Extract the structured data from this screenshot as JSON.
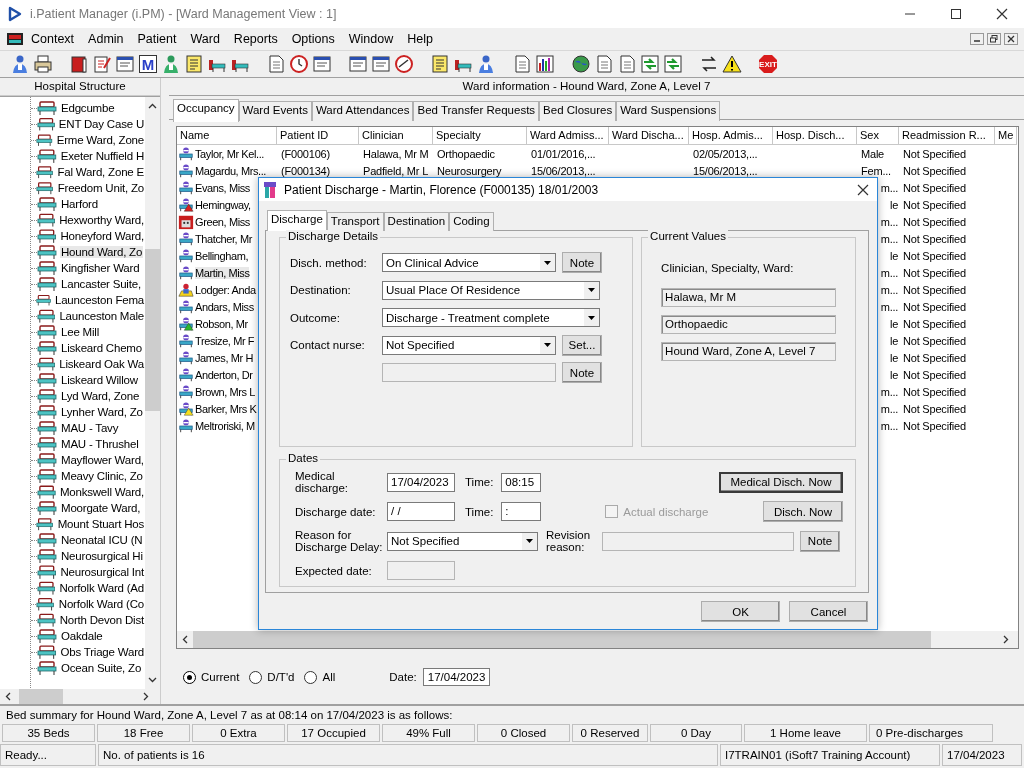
{
  "window": {
    "title": "i.Patient Manager (i.PM) - [Ward Management View : 1]"
  },
  "menu": [
    {
      "label": "Context"
    },
    {
      "label": "Admin"
    },
    {
      "label": "Patient"
    },
    {
      "label": "Ward"
    },
    {
      "label": "Reports"
    },
    {
      "label": "Options"
    },
    {
      "label": "Window"
    },
    {
      "label": "Help"
    }
  ],
  "toolbar": {
    "letter_icon": "M",
    "exit_label": "EXIT"
  },
  "hospital_structure": {
    "title": "Hospital Structure",
    "items": [
      {
        "label": "Edgcumbe",
        "selected": false
      },
      {
        "label": "ENT Day Case U",
        "selected": false
      },
      {
        "label": "Erme Ward, Zone",
        "selected": false
      },
      {
        "label": "Exeter Nuffield H",
        "selected": false
      },
      {
        "label": "Fal Ward, Zone E",
        "selected": false
      },
      {
        "label": "Freedom Unit, Zo",
        "selected": false
      },
      {
        "label": "Harford",
        "selected": false
      },
      {
        "label": "Hexworthy Ward,",
        "selected": false
      },
      {
        "label": "Honeyford Ward,",
        "selected": false
      },
      {
        "label": "Hound Ward, Zo",
        "selected": true
      },
      {
        "label": "Kingfisher Ward",
        "selected": false
      },
      {
        "label": "Lancaster Suite,",
        "selected": false
      },
      {
        "label": "Launceston Fema",
        "selected": false
      },
      {
        "label": "Launceston Male",
        "selected": false
      },
      {
        "label": "Lee Mill",
        "selected": false
      },
      {
        "label": "Liskeard Chemo",
        "selected": false
      },
      {
        "label": "Liskeard Oak Wa",
        "selected": false
      },
      {
        "label": "Liskeard Willow",
        "selected": false
      },
      {
        "label": "Lyd Ward, Zone",
        "selected": false
      },
      {
        "label": "Lynher Ward, Zo",
        "selected": false
      },
      {
        "label": "MAU - Tavy",
        "selected": false
      },
      {
        "label": "MAU - Thrushel",
        "selected": false
      },
      {
        "label": "Mayflower Ward,",
        "selected": false
      },
      {
        "label": "Meavy Clinic, Zo",
        "selected": false
      },
      {
        "label": "Monkswell Ward,",
        "selected": false
      },
      {
        "label": "Moorgate Ward,",
        "selected": false
      },
      {
        "label": "Mount Stuart Hos",
        "selected": false
      },
      {
        "label": "Neonatal ICU (N",
        "selected": false
      },
      {
        "label": "Neurosurgical Hi",
        "selected": false
      },
      {
        "label": "Neurosurgical Int",
        "selected": false
      },
      {
        "label": "Norfolk Ward (Ad",
        "selected": false
      },
      {
        "label": "Norfolk Ward (Co",
        "selected": false
      },
      {
        "label": "North Devon Dist",
        "selected": false
      },
      {
        "label": "Oakdale",
        "selected": false
      },
      {
        "label": "Obs Triage Ward",
        "selected": false
      },
      {
        "label": "Ocean Suite, Zo",
        "selected": false
      }
    ]
  },
  "ward_info": "Ward information - Hound Ward, Zone A, Level 7",
  "tabs": [
    {
      "label": "Occupancy",
      "selected": true
    },
    {
      "label": "Ward Events",
      "selected": false
    },
    {
      "label": "Ward Attendances",
      "selected": false
    },
    {
      "label": "Bed Transfer Requests",
      "selected": false
    },
    {
      "label": "Bed Closures",
      "selected": false
    },
    {
      "label": "Ward Suspensions",
      "selected": false
    }
  ],
  "table": {
    "columns": [
      "Name",
      "Patient ID",
      "Clinician",
      "Specialty",
      "Ward Admiss...",
      "Ward Discha...",
      "Hosp. Admis...",
      "Hosp. Disch...",
      "Sex",
      "Readmission R...",
      "Me"
    ],
    "rows": [
      {
        "kind": "patient",
        "selected": false,
        "name": "Taylor, Mr Kel...",
        "patient_id": "(F000106)",
        "clinician": "Halawa, Mr M",
        "specialty": "Orthopaedic",
        "ward_admission": "01/01/2016,...",
        "hosp_admission": "02/05/2013,...",
        "sex": "Male",
        "readmission": "Not Specified"
      },
      {
        "kind": "patient",
        "selected": false,
        "name": "Magardu, Mrs...",
        "patient_id": "(F000134)",
        "clinician": "Padfield, Mr L",
        "specialty": "Neurosurgery",
        "ward_admission": "15/06/2013,...",
        "hosp_admission": "15/06/2013,...",
        "sex": "Fem...",
        "readmission": "Not Specified"
      },
      {
        "kind": "patient",
        "selected": false,
        "name": "Evans, Miss",
        "sex": "m...",
        "readmission": "Not Specified"
      },
      {
        "kind": "alert-red",
        "selected": false,
        "name": "Hemingway,",
        "sex": "le",
        "readmission": "Not Specified"
      },
      {
        "kind": "flag",
        "selected": false,
        "name": "Green, Miss",
        "sex": "m...",
        "readmission": "Not Specified"
      },
      {
        "kind": "patient",
        "selected": false,
        "name": "Thatcher, Mr",
        "sex": "m...",
        "readmission": "Not Specified"
      },
      {
        "kind": "patient",
        "selected": false,
        "name": "Bellingham,",
        "sex": "le",
        "readmission": "Not Specified"
      },
      {
        "kind": "patient",
        "selected": true,
        "name": "Martin, Miss",
        "sex": "m...",
        "readmission": "Not Specified"
      },
      {
        "kind": "lodger",
        "selected": false,
        "name": "Lodger: Anda",
        "sex": "m...",
        "readmission": "Not Specified"
      },
      {
        "kind": "patient",
        "selected": false,
        "name": "Andars, Miss",
        "sex": "m...",
        "readmission": "Not Specified"
      },
      {
        "kind": "alert-green",
        "selected": false,
        "name": "Robson, Mr",
        "sex": "le",
        "readmission": "Not Specified"
      },
      {
        "kind": "patient",
        "selected": false,
        "name": "Tresize, Mr F",
        "sex": "le",
        "readmission": "Not Specified"
      },
      {
        "kind": "patient",
        "selected": false,
        "name": "James, Mr H",
        "sex": "le",
        "readmission": "Not Specified"
      },
      {
        "kind": "patient",
        "selected": false,
        "name": "Anderton, Dr",
        "sex": "le",
        "readmission": "Not Specified"
      },
      {
        "kind": "patient",
        "selected": false,
        "name": "Brown, Mrs L",
        "sex": "m...",
        "readmission": "Not Specified"
      },
      {
        "kind": "alert-yellow",
        "selected": false,
        "name": "Barker, Mrs K",
        "sex": "m...",
        "readmission": "Not Specified"
      },
      {
        "kind": "patient",
        "selected": false,
        "name": "Meltroriski, M",
        "sex": "m...",
        "readmission": "Not Specified"
      }
    ]
  },
  "filter": {
    "options": [
      {
        "label": "Current",
        "selected": true
      },
      {
        "label": "D/T'd",
        "selected": false
      },
      {
        "label": "All",
        "selected": false
      }
    ],
    "date_label": "Date:",
    "date": "17/04/2023"
  },
  "bed_summary": {
    "caption": "Bed summary for Hound Ward, Zone A, Level 7 as at 08:14 on 17/04/2023 is as follows:",
    "counts": [
      "35 Beds",
      "18 Free",
      "0 Extra",
      "17 Occupied",
      "49% Full",
      "0 Closed",
      "0 Reserved",
      "0 Day",
      "1 Home leave",
      "0 Pre-discharges"
    ]
  },
  "status_bar": {
    "status": "Ready...",
    "patients": "No. of patients is 16",
    "account": "I7TRAIN01 (iSoft7 Training Account)",
    "date": "17/04/2023"
  },
  "dialog": {
    "title": "Patient Discharge - Martin, Florence (F000135) 18/01/2003",
    "tabs": [
      {
        "label": "Discharge",
        "selected": true
      },
      {
        "label": "Transport",
        "selected": false
      },
      {
        "label": "Destination",
        "selected": false
      },
      {
        "label": "Coding",
        "selected": false
      }
    ],
    "details": {
      "title": "Discharge Details",
      "method_label": "Disch. method:",
      "method": "On Clinical Advice",
      "method_note": "Note",
      "destination_label": "Destination:",
      "destination": "Usual Place Of Residence",
      "outcome_label": "Outcome:",
      "outcome": "Discharge - Treatment complete",
      "nurse_label": "Contact nurse:",
      "nurse": "Not Specified",
      "nurse_button": "Set...",
      "extra_note": "Note"
    },
    "current": {
      "title": "Current Values",
      "caption": "Clinician, Specialty, Ward:",
      "values": [
        "Halawa, Mr M",
        "Orthopaedic",
        "Hound Ward, Zone A, Level 7"
      ]
    },
    "dates": {
      "title": "Dates",
      "medical_label": "Medical discharge:",
      "medical_date": "17/04/2023",
      "medical_time_label": "Time:",
      "medical_time": "08:15",
      "medical_now": "Medical Disch. Now",
      "discharge_label": "Discharge date:",
      "discharge_date": "/ /",
      "discharge_time_label": "Time:",
      "discharge_time": ":",
      "actual": {
        "label": "Actual discharge",
        "checked": false,
        "disabled": true
      },
      "disch_now": "Disch. Now",
      "delay_label": "Reason for Discharge Delay:",
      "delay": "Not Specified",
      "revision_label": "Revision reason:",
      "revision_note": "Note",
      "expected_label": "Expected date:"
    },
    "buttons": [
      "OK",
      "Cancel"
    ]
  }
}
